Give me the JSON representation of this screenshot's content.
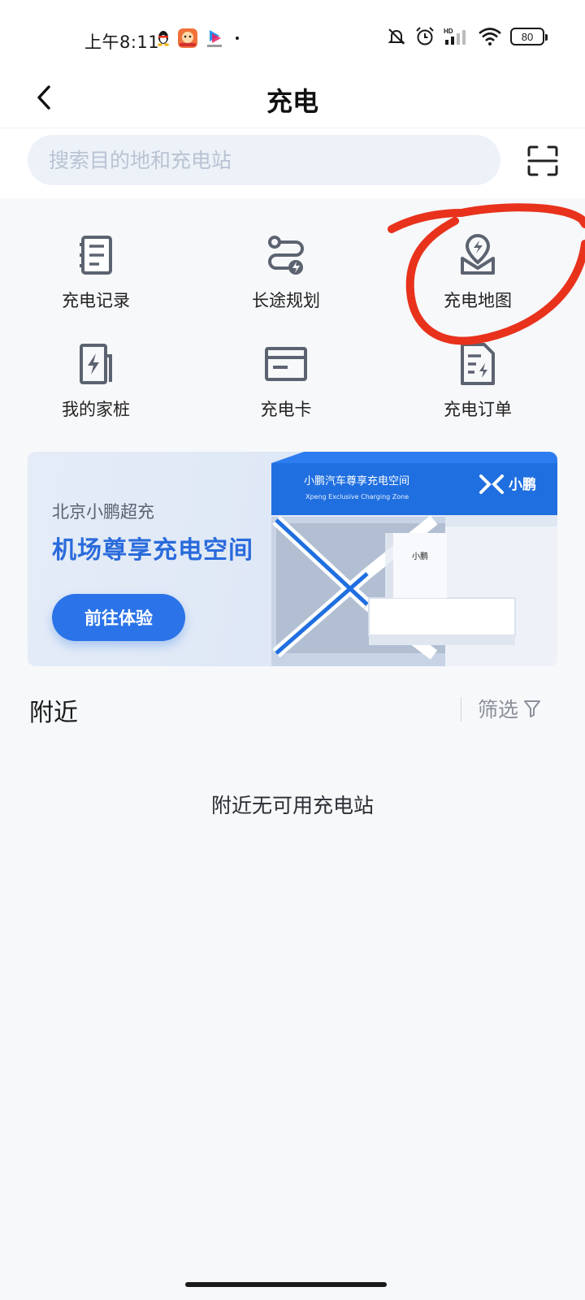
{
  "status_bar": {
    "time": "上午8:11",
    "battery": "80"
  },
  "header": {
    "title": "充电"
  },
  "search": {
    "placeholder": "搜索目的地和充电站"
  },
  "menu": {
    "items": [
      {
        "label": "充电记录",
        "icon": "record-icon"
      },
      {
        "label": "长途规划",
        "icon": "route-plan-icon"
      },
      {
        "label": "充电地图",
        "icon": "map-pin-icon"
      },
      {
        "label": "我的家桩",
        "icon": "home-charger-icon"
      },
      {
        "label": "充电卡",
        "icon": "card-icon"
      },
      {
        "label": "充电订单",
        "icon": "order-icon"
      }
    ]
  },
  "banner": {
    "subtitle": "北京小鹏超充",
    "title": "机场尊享充电空间",
    "button": "前往体验",
    "sign_cn": "小鹏汽车尊享充电空间",
    "sign_en": "Xpeng Exclusive Charging Zone",
    "brand": "小鹏",
    "desk_brand": "小鹏"
  },
  "nearby": {
    "title": "附近",
    "filter_label": "筛选",
    "empty_text": "附近无可用充电站"
  },
  "colors": {
    "accent": "#2b73e8",
    "annotation": "#e8321c",
    "icon_gray": "#5c6370"
  }
}
